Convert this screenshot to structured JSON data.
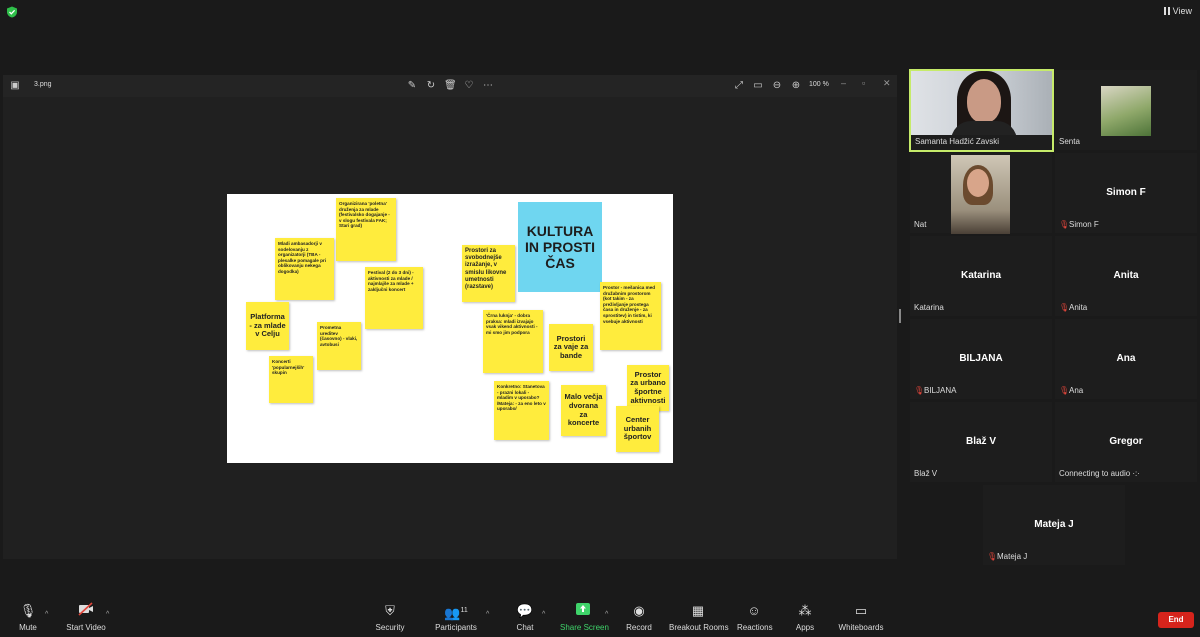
{
  "top": {
    "view_label": "View"
  },
  "viewer": {
    "file_name": "3.png",
    "zoom": "100 %"
  },
  "slide": {
    "title": "KULTURA IN PROSTI ČAS",
    "notes": [
      "Organizirana 'poletna' druženja za mlade (festivalsko dogajanje - v slogu festivala FAK; Stari grad)",
      "Mladi ambasadorji v sodelovanju z organizatorji (TBA - plesalke pomagale pri oblikovanju nekega dogodka)",
      "Festival (2 do 3 dni) - aktivnosti za mlade / najmlajše za mlade + zaključni koncert",
      "Platforma - za mlade v Celju",
      "Prometna ureditev (časovno) - vlaki, avtobusi",
      "Koncerti 'popularnejših' skupin",
      "Prostori za svobodnejše izražanje, v smislu likovne umetnosti (razstave)",
      "'Črna luknja' - dobra praksa: mladi izvajajo vsak vikend aktivnosti - mi smo jim podpora",
      "Prostori za vaje za bande",
      "Prostor - mešanica med družabnim prostorom (kot takim - za preživljanje prostega časa in druženje - za sprostitev) in tistim, ki vsebuje aktivnosti",
      "Konkretno: Stanetova - prazni lokali - mladim v uporabo? /Mateja: - za eno leto v uporabo/",
      "Malo večja dvorana za koncerte",
      "Prostor za urbano športne aktivnosti",
      "Center urbanih športov"
    ]
  },
  "participants": [
    {
      "name": "Samanta Hadžić Zavski",
      "center": "",
      "muted": false
    },
    {
      "name": "Senta",
      "center": "",
      "muted": false
    },
    {
      "name": "Nat",
      "center": "",
      "muted": false
    },
    {
      "name": "Simon F",
      "center": "Simon F",
      "muted": true
    },
    {
      "name": "Katarina",
      "center": "Katarina",
      "muted": false
    },
    {
      "name": "Anita",
      "center": "Anita",
      "muted": true
    },
    {
      "name": "BILJANA",
      "center": "BILJANA",
      "muted": true
    },
    {
      "name": "Ana",
      "center": "Ana",
      "muted": true
    },
    {
      "name": "Blaž V",
      "center": "Blaž V",
      "muted": false
    },
    {
      "name": "Connecting to audio ·:·",
      "center": "Gregor",
      "muted": false
    },
    {
      "name": "Mateja J",
      "center": "Mateja J",
      "muted": true
    }
  ],
  "toolbar": {
    "mute": "Mute",
    "start_video": "Start Video",
    "security": "Security",
    "participants": "Participants",
    "participants_count": "11",
    "chat": "Chat",
    "share_screen": "Share Screen",
    "record": "Record",
    "breakout": "Breakout Rooms",
    "reactions": "Reactions",
    "apps": "Apps",
    "whiteboards": "Whiteboards",
    "end": "End"
  },
  "colors": {
    "note": "#ffec3d",
    "title_note": "#6fd6f0",
    "active_speaker": "#c6eb6a",
    "share_green": "#3fd46a",
    "end_red": "#d6241c"
  }
}
